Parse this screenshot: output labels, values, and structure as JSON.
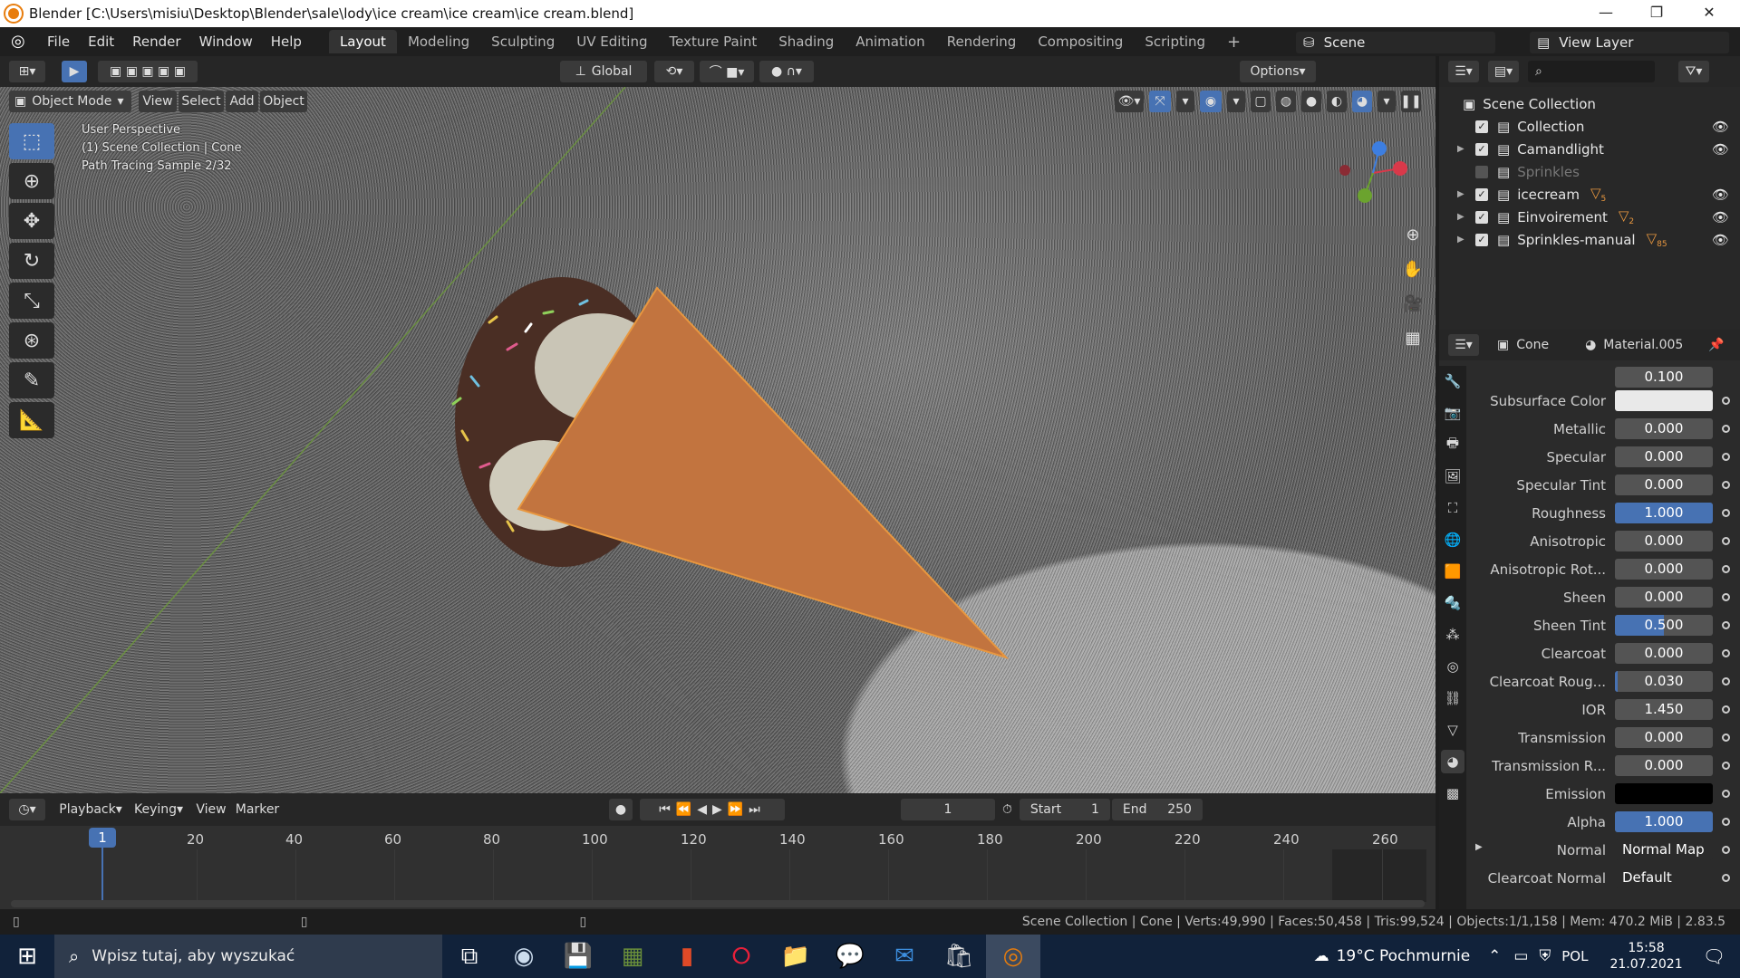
{
  "window": {
    "title": "Blender [C:\\Users\\misiu\\Desktop\\Blender\\sale\\lody\\ice cream\\ice cream\\ice cream.blend]"
  },
  "menu": [
    "File",
    "Edit",
    "Render",
    "Window",
    "Help"
  ],
  "workspaces": [
    "Layout",
    "Modeling",
    "Sculpting",
    "UV Editing",
    "Texture Paint",
    "Shading",
    "Animation",
    "Rendering",
    "Compositing",
    "Scripting"
  ],
  "scene": {
    "name": "Scene",
    "view_layer": "View Layer"
  },
  "viewport": {
    "mode": "Object Mode",
    "menus": [
      "View",
      "Select",
      "Add",
      "Object"
    ],
    "transform": "Global",
    "options": "Options",
    "overlay_lines": [
      "User Perspective",
      "(1) Scene Collection | Cone",
      "Path Tracing Sample 2/32"
    ]
  },
  "outliner": {
    "root": "Scene Collection",
    "items": [
      {
        "label": "Collection",
        "checked": true,
        "expand": false
      },
      {
        "label": "Camandlight",
        "checked": true,
        "expand": true
      },
      {
        "label": "Sprinkles",
        "checked": false,
        "expand": false
      },
      {
        "label": "icecream",
        "checked": true,
        "expand": true,
        "badge": "5"
      },
      {
        "label": "Einvoirement",
        "checked": true,
        "expand": true,
        "badge": "2"
      },
      {
        "label": "Sprinkles-manual",
        "checked": true,
        "expand": true,
        "badge": "85"
      }
    ]
  },
  "properties": {
    "object": "Cone",
    "material": "Material.005",
    "top_value": "0.100",
    "rows": [
      {
        "label": "Subsurface Color",
        "value": "",
        "color": "#e9e9e9",
        "fill": 0
      },
      {
        "label": "Metallic",
        "value": "0.000",
        "fill": 0
      },
      {
        "label": "Specular",
        "value": "0.000",
        "fill": 0
      },
      {
        "label": "Specular Tint",
        "value": "0.000",
        "fill": 0
      },
      {
        "label": "Roughness",
        "value": "1.000",
        "fill": 1
      },
      {
        "label": "Anisotropic",
        "value": "0.000",
        "fill": 0
      },
      {
        "label": "Anisotropic Rot...",
        "value": "0.000",
        "fill": 0
      },
      {
        "label": "Sheen",
        "value": "0.000",
        "fill": 0
      },
      {
        "label": "Sheen Tint",
        "value": "0.500",
        "fill": 0.5
      },
      {
        "label": "Clearcoat",
        "value": "0.000",
        "fill": 0
      },
      {
        "label": "Clearcoat Roug...",
        "value": "0.030",
        "fill": 0.03
      },
      {
        "label": "IOR",
        "value": "1.450",
        "fill": 0
      },
      {
        "label": "Transmission",
        "value": "0.000",
        "fill": 0
      },
      {
        "label": "Transmission R...",
        "value": "0.000",
        "fill": 0
      },
      {
        "label": "Emission",
        "value": "",
        "color": "#000000",
        "fill": 0
      },
      {
        "label": "Alpha",
        "value": "1.000",
        "fill": 1
      },
      {
        "label": "Normal",
        "value": "Normal Map",
        "fill": 0,
        "expand": true
      },
      {
        "label": "Clearcoat Normal",
        "value": "Default",
        "fill": 0
      }
    ]
  },
  "timeline": {
    "menus": [
      "Playback",
      "Keying",
      "View",
      "Marker"
    ],
    "current_frame": "1",
    "start_label": "Start",
    "start": "1",
    "end_label": "End",
    "end": "250",
    "ticks": [
      "20",
      "40",
      "60",
      "80",
      "100",
      "120",
      "140",
      "160",
      "180",
      "200",
      "220",
      "240",
      "260"
    ]
  },
  "status": "Scene Collection | Cone | Verts:49,990 | Faces:50,458 | Tris:99,524 | Objects:1/1,158 | Mem: 470.2 MiB | 2.83.5",
  "taskbar": {
    "search_placeholder": "Wpisz tutaj, aby wyszukać",
    "weather": "19°C  Pochmurnie",
    "lang": "POL",
    "time": "15:58",
    "date": "21.07.2021"
  }
}
